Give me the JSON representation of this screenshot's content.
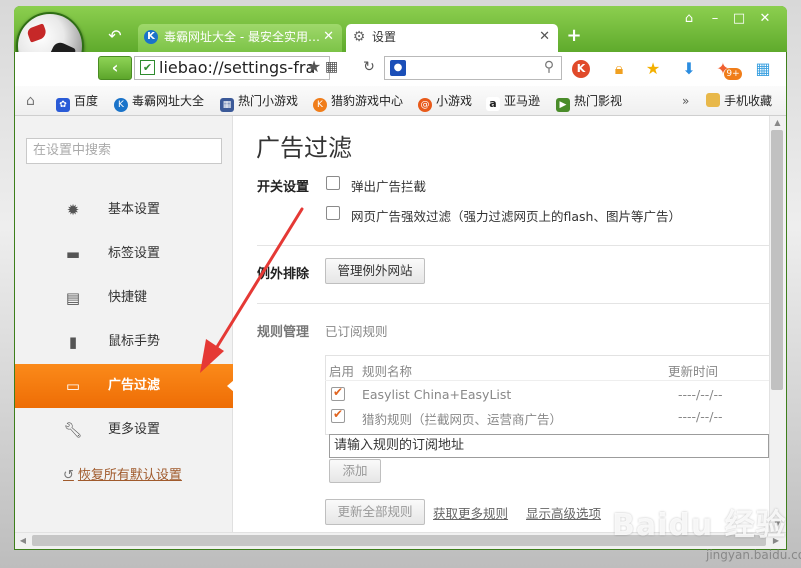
{
  "window": {
    "tabs": [
      {
        "label": "毒霸网址大全 - 最安全实用…",
        "icon": "k-logo-icon",
        "active": false
      },
      {
        "label": "设置",
        "icon": "gear-icon",
        "active": true
      }
    ],
    "new_tab": "+",
    "controls": {
      "skin": "⌂",
      "minimize": "–",
      "maximize": "□",
      "close": "✕"
    }
  },
  "toolbar": {
    "url": "liebao://settings-fra",
    "search_placeholder": "",
    "extension_badge": "9+"
  },
  "bookmarks": [
    {
      "label": "百度",
      "icon": "baidu-paw-icon",
      "color": "#2a5bd7"
    },
    {
      "label": "毒霸网址大全",
      "icon": "k-logo-icon",
      "color": "#1a73c9"
    },
    {
      "label": "热门小游戏",
      "icon": "game-grid-icon",
      "color": "#3b5998"
    },
    {
      "label": "猎豹游戏中心",
      "icon": "cheetah-game-icon",
      "color": "#f07d1a"
    },
    {
      "label": "小游戏",
      "icon": "swirl-icon",
      "color": "#e85a1a"
    },
    {
      "label": "亚马逊",
      "icon": "amazon-icon",
      "color": "#222222"
    },
    {
      "label": "热门影视",
      "icon": "play-icon",
      "color": "#4a8c2a"
    }
  ],
  "bookmarks_more": "»",
  "bookmarks_folder": "手机收藏",
  "sidebar": {
    "search_placeholder": "在设置中搜索",
    "items": [
      {
        "label": "基本设置",
        "icon": "gear-icon"
      },
      {
        "label": "标签设置",
        "icon": "tab-icon"
      },
      {
        "label": "快捷键",
        "icon": "keyboard-icon"
      },
      {
        "label": "鼠标手势",
        "icon": "mouse-icon"
      },
      {
        "label": "广告过滤",
        "icon": "window-icon",
        "active": true
      },
      {
        "label": "更多设置",
        "icon": "wrench-icon"
      }
    ],
    "restore_link": "恢复所有默认设置"
  },
  "content": {
    "title": "广告过滤",
    "switch_section": {
      "label": "开关设置",
      "options": [
        {
          "label": "弹出广告拦截",
          "checked": false
        },
        {
          "label": "网页广告强效过滤（强力过滤网页上的flash、图片等广告）",
          "checked": false
        }
      ]
    },
    "exception_section": {
      "label": "例外排除",
      "button": "管理例外网站"
    },
    "rules_section": {
      "label": "规则管理",
      "sublabel": "已订阅规则",
      "columns": [
        "启用",
        "规则名称",
        "更新时间"
      ],
      "rows": [
        {
          "enabled": true,
          "name": "Easylist China+EasyList",
          "updated": "----/--/--"
        },
        {
          "enabled": true,
          "name": "猎豹规则（拦截网页、运营商广告）",
          "updated": "----/--/--"
        }
      ],
      "input_value": "请输入规则的订阅地址",
      "add_button": "添加",
      "update_all_button": "更新全部规则",
      "more_rules_link": "获取更多规则",
      "advanced_link": "显示高级选项"
    }
  },
  "watermark": {
    "brand": "Baidu 经验",
    "url": "jingyan.baidu.com"
  },
  "colors": {
    "frame_green": "#6db83a",
    "active_orange": "#f47b0f",
    "annotation_red": "#e53935"
  }
}
